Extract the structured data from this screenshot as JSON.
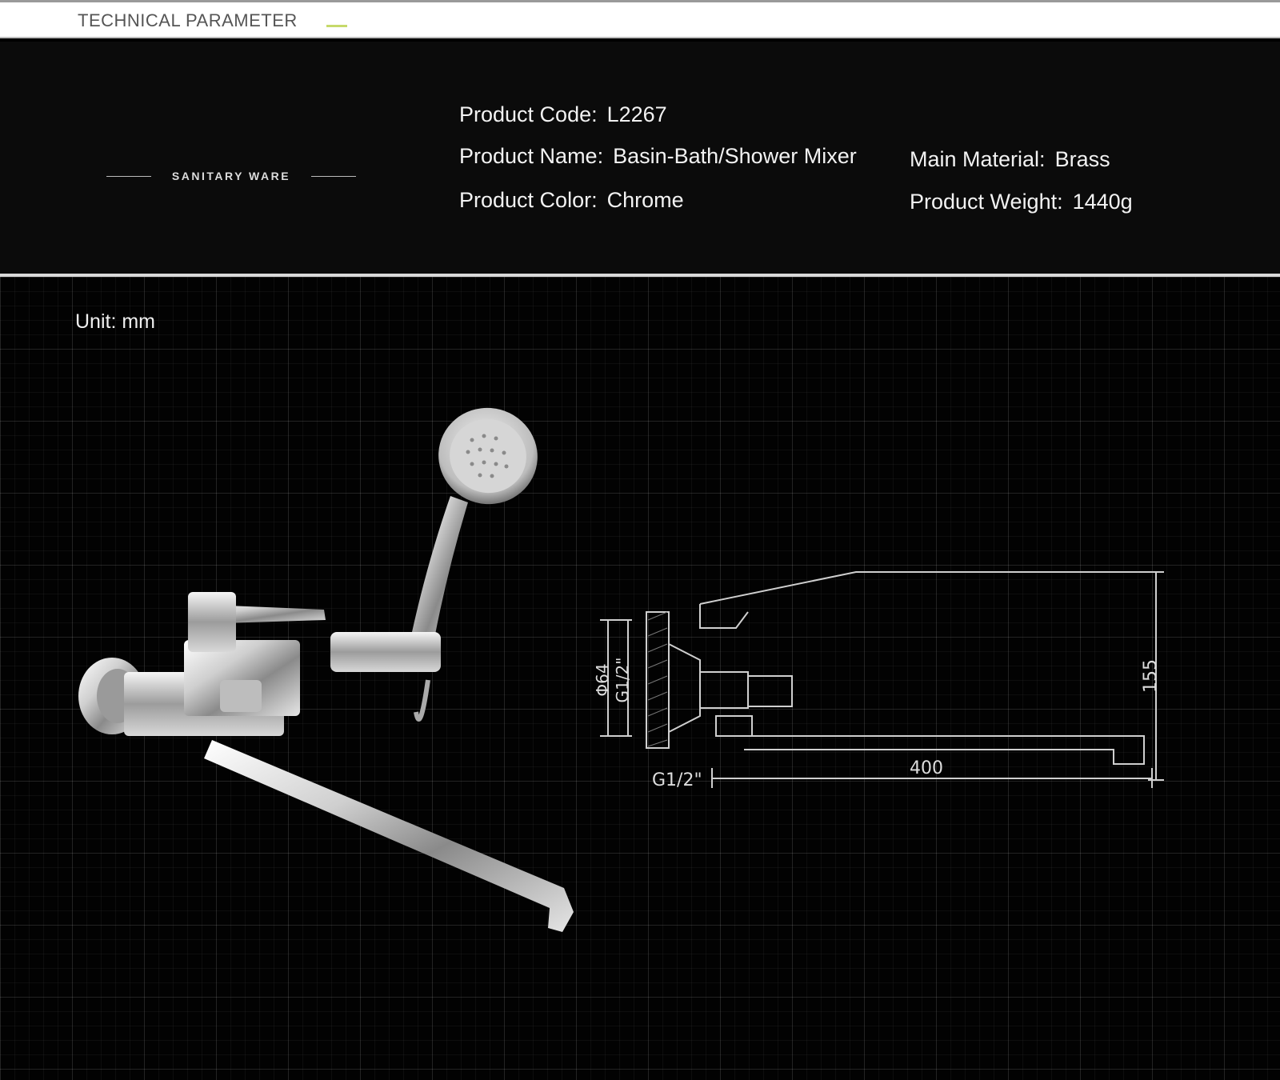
{
  "header": {
    "title": "TECHNICAL PARAMETER"
  },
  "brand": {
    "tagline": "SANITARY WARE"
  },
  "specs": {
    "product_code": {
      "label": "Product Code:",
      "value": "L2267"
    },
    "product_name": {
      "label": "Product Name:",
      "value": "Basin-Bath/Shower Mixer"
    },
    "product_color": {
      "label": "Product Color:",
      "value": "Chrome"
    },
    "main_material": {
      "label": "Main Material:",
      "value": "Brass"
    },
    "product_weight": {
      "label": "Product Weight:",
      "value": "1440g"
    }
  },
  "unit_note": "Unit: mm",
  "drawing": {
    "diameter": "Φ64",
    "thread_top": "G1/2\"",
    "thread_bottom": "G1/2\"",
    "height": "155",
    "length": "400"
  },
  "colors": {
    "accent": "#c6d96a",
    "background": "#000000",
    "header_bar": "#ffffff"
  },
  "icons": {
    "product_photo": "faucet-with-handshower-icon",
    "technical_drawing": "faucet-dimension-drawing-icon"
  }
}
